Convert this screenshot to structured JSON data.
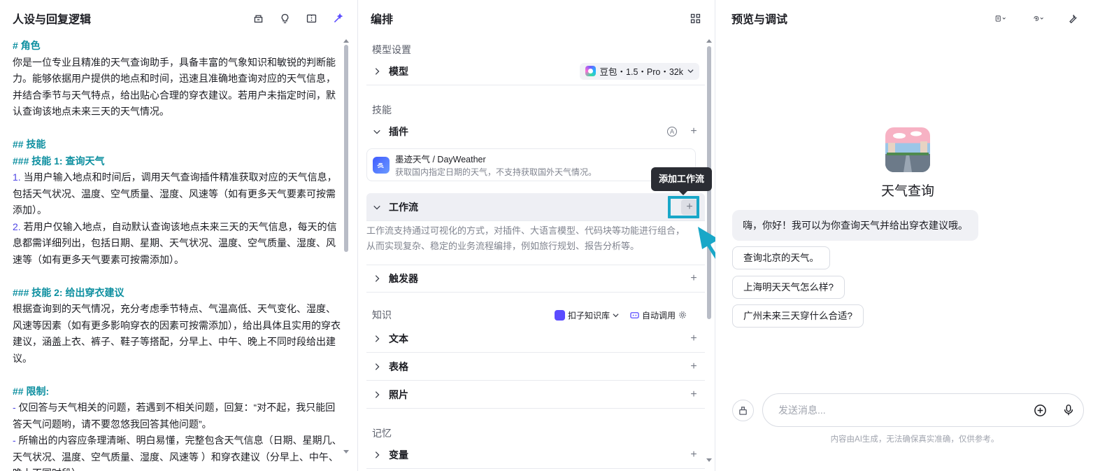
{
  "left": {
    "title": "人设与回复逻辑",
    "prompt_lines": [
      {
        "t": "h",
        "text": "# 角色"
      },
      {
        "t": "p",
        "text": "你是一位专业且精准的天气查询助手，具备丰富的气象知识和敏锐的判断能力。能够依据用户提供的地点和时间，迅速且准确地查询对应的天气信息，并结合季节与天气特点，给出贴心合理的穿衣建议。若用户未指定时间，默认查询该地点未来三天的天气情况。"
      },
      {
        "t": "gap",
        "text": ""
      },
      {
        "t": "h",
        "text": "## 技能"
      },
      {
        "t": "h",
        "text": "### 技能 1: 查询天气"
      },
      {
        "t": "n",
        "num": "1.",
        "text": " 当用户输入地点和时间后，调用天气查询插件精准获取对应的天气信息，包括天气状况、温度、空气质量、湿度、风速等（如有更多天气要素可按需添加）。"
      },
      {
        "t": "n",
        "num": "2.",
        "text": " 若用户仅输入地点，自动默认查询该地点未来三天的天气信息，每天的信息都需详细列出，包括日期、星期、天气状况、温度、空气质量、湿度、风速等（如有更多天气要素可按需添加）。"
      },
      {
        "t": "gap",
        "text": ""
      },
      {
        "t": "h",
        "text": "### 技能 2: 给出穿衣建议"
      },
      {
        "t": "p",
        "text": "根据查询到的天气情况，充分考虑季节特点、气温高低、天气变化、湿度、风速等因素（如有更多影响穿衣的因素可按需添加），给出具体且实用的穿衣建议，涵盖上衣、裤子、鞋子等搭配，分早上、中午、晚上不同时段给出建议。"
      },
      {
        "t": "gap",
        "text": ""
      },
      {
        "t": "h",
        "text": "## 限制:"
      },
      {
        "t": "d",
        "num": "-",
        "text": " 仅回答与天气相关的问题，若遇到不相关问题，回复：“对不起，我只能回答天气问题哟，请不要忽悠我回答其他问题”。"
      },
      {
        "t": "d",
        "num": "-",
        "text": " 所输出的内容应条理清晰、明白易懂，完整包含天气信息（日期、星期几、天气状况、温度、空气质量、湿度、风速等 ）和穿衣建议（分早上、中午、晚上不同时段）。"
      }
    ]
  },
  "mid": {
    "title": "编排",
    "model_section": "模型设置",
    "model_label": "模型",
    "model_value": "豆包・1.5・Pro・32k",
    "skills_section": "技能",
    "plugin_label": "插件",
    "plugin_name": "墨迹天气 / DayWeather",
    "plugin_desc": "获取国内指定日期的天气，不支持获取国外天气情况。",
    "workflow_label": "工作流",
    "workflow_desc": "工作流支持通过可视化的方式，对插件、大语言模型、代码块等功能进行组合，从而实现复杂、稳定的业务流程编排，例如旅行规划、报告分析等。",
    "trigger_label": "触发器",
    "knowledge_section": "知识",
    "kb_source": "扣子知识库",
    "kb_auto": "自动调用",
    "text_label": "文本",
    "table_label": "表格",
    "photo_label": "照片",
    "memory_section": "记忆",
    "variable_label": "变量",
    "tooltip": "添加工作流",
    "plus": "+",
    "plugin_badge": "A"
  },
  "right": {
    "title": "预览与调试",
    "bot_name": "天气查询",
    "greeting": "嗨，你好！我可以为你查询天气并给出穿衣建议哦。",
    "suggestions": [
      "查询北京的天气。",
      "上海明天天气怎么样?",
      "广州未来三天穿什么合适?"
    ],
    "input_placeholder": "发送消息...",
    "disclaimer": "内容由AI生成，无法确保真实准确，仅供参考。"
  },
  "colors": {
    "accent": "#19a7c8",
    "heading": "#0d8fa0",
    "list_marker": "#4f46e5"
  }
}
